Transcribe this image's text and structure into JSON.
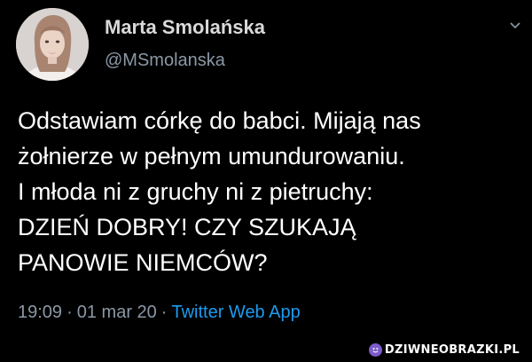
{
  "tweet": {
    "author": {
      "display_name": "Marta Smolańska",
      "handle": "@MSmolanska",
      "avatar_icon": "profile-photo"
    },
    "menu_icon": "chevron-down-icon",
    "text_lines": [
      "Odstawiam córkę do babci. Mijają nas",
      "żołnierze w pełnym umundurowaniu.",
      "I młoda ni z gruchy ni z pietruchy:",
      "DZIEŃ DOBRY! CZY SZUKAJĄ",
      "PANOWIE NIEMCÓW?"
    ],
    "time": "19:09",
    "separator": "·",
    "date": "01 mar 20",
    "source": "Twitter Web App"
  },
  "watermark": {
    "text": "DZIWNEOBRAZKI.PL",
    "icon": "smiley-badge-icon"
  },
  "colors": {
    "background": "#000000",
    "text": "#ffffff",
    "name": "#d9d9d9",
    "secondary": "#8b98a5",
    "link": "#1d9bf0",
    "watermark_badge": "#7b5cc9"
  }
}
